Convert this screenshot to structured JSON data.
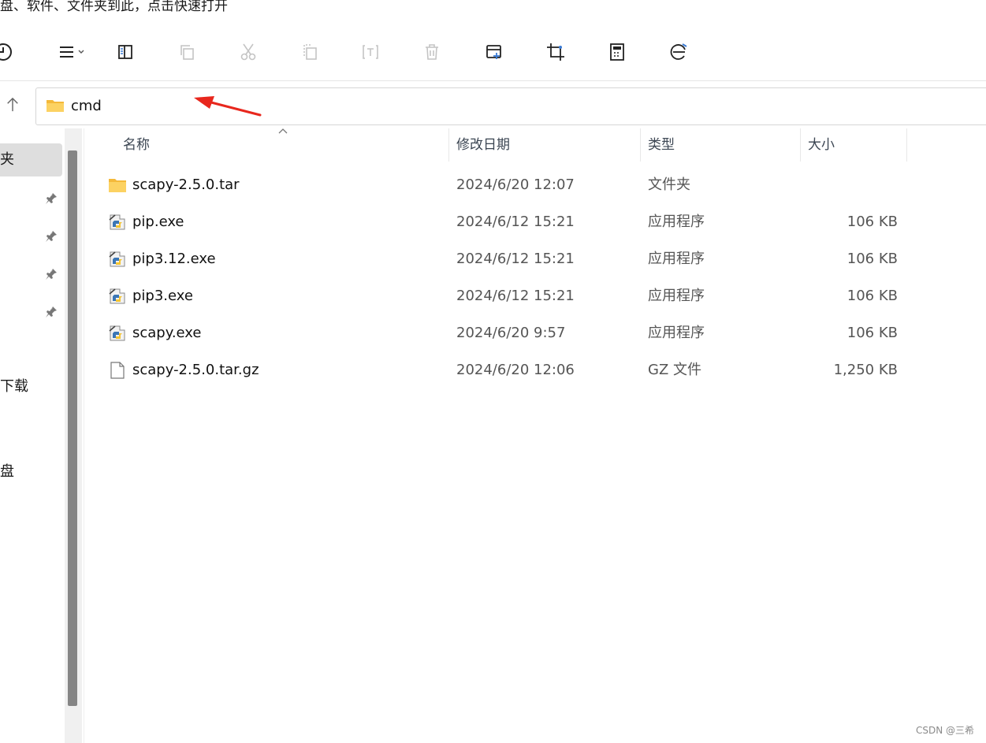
{
  "top_hint": "盘、软件、文件夹到此，点击快速打开",
  "address": {
    "path": "cmd"
  },
  "nav": {
    "selected_label": "夹",
    "download_label": "下载",
    "disk_label": "盘"
  },
  "columns": {
    "name": "名称",
    "date": "修改日期",
    "type": "类型",
    "size": "大小"
  },
  "files": [
    {
      "name": "scapy-2.5.0.tar",
      "date": "2024/6/20 12:07",
      "type": "文件夹",
      "size": "",
      "icon": "folder-icon"
    },
    {
      "name": "pip.exe",
      "date": "2024/6/12 15:21",
      "type": "应用程序",
      "size": "106 KB",
      "icon": "python-exe-icon"
    },
    {
      "name": "pip3.12.exe",
      "date": "2024/6/12 15:21",
      "type": "应用程序",
      "size": "106 KB",
      "icon": "python-exe-icon"
    },
    {
      "name": "pip3.exe",
      "date": "2024/6/12 15:21",
      "type": "应用程序",
      "size": "106 KB",
      "icon": "python-exe-icon"
    },
    {
      "name": "scapy.exe",
      "date": "2024/6/20 9:57",
      "type": "应用程序",
      "size": "106 KB",
      "icon": "python-exe-icon"
    },
    {
      "name": "scapy-2.5.0.tar.gz",
      "date": "2024/6/20 12:06",
      "type": "GZ 文件",
      "size": "1,250 KB",
      "icon": "file-icon"
    }
  ],
  "watermark": "CSDN @三希",
  "colors": {
    "folder": "#f8c84a",
    "arrow": "#e8271d",
    "scroll_thumb": "#858585"
  }
}
